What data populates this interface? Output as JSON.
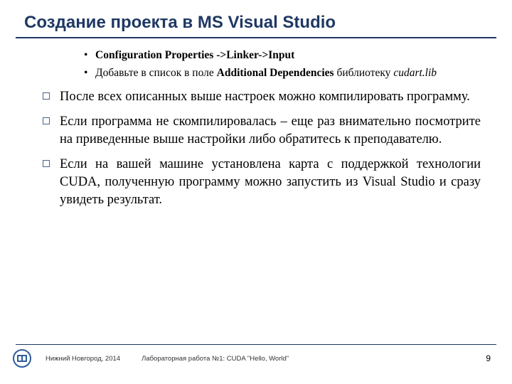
{
  "title": "Создание проекта в MS Visual Studio",
  "sub": {
    "a": {
      "bold": "Configuration Properties ->Linker->Input"
    },
    "b": {
      "t1": "Добавьте в список в поле ",
      "bold": "Additional Dependencies",
      "t2": " библиотеку ",
      "ital": "cudart.lib"
    }
  },
  "bullets": {
    "b1": "После всех описанных выше настроек можно компилировать программу.",
    "b2": "Если программа не скомпилировалась – еще раз внимательно посмотрите на приведенные выше настройки либо обратитесь к преподавателю.",
    "b3": "Если на вашей машине установлена карта с поддержкой технологии CUDA, полученную программу можно запустить из Visual Studio и сразу увидеть результат."
  },
  "footer": {
    "location": "Нижний Новгород, 2014",
    "lab": "Лабораторная работа №1: CUDA \"Hello, World\"",
    "page": "9"
  }
}
